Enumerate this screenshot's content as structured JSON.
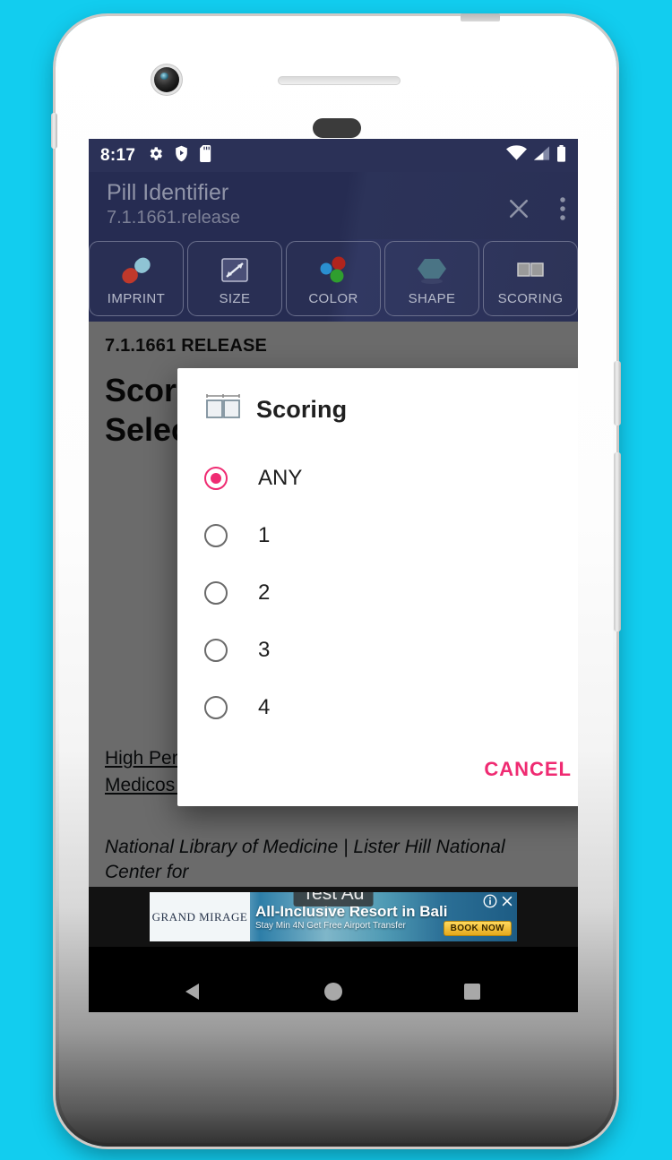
{
  "status_bar": {
    "time": "8:17",
    "left_icons": [
      "gear-icon",
      "shield-play-icon",
      "sd-card-icon"
    ],
    "right_icons": [
      "wifi-icon",
      "cellular-signal-icon",
      "battery-icon"
    ]
  },
  "app_bar": {
    "title": "Pill Identifier",
    "version": "7.1.1661.release",
    "close_label": "✕",
    "overflow_label": "⋮"
  },
  "tabs": [
    {
      "label": "IMPRINT",
      "icon": "pill-capsule-icon"
    },
    {
      "label": "SIZE",
      "icon": "size-ruler-icon"
    },
    {
      "label": "COLOR",
      "icon": "color-spheres-icon"
    },
    {
      "label": "SHAPE",
      "icon": "hexagon-shape-icon"
    },
    {
      "label": "SCORING",
      "icon": "scoring-table-icon"
    }
  ],
  "page": {
    "release_heading": "7.1.1661 RELEASE",
    "title_line1": "Scoring",
    "title_line2": "Selection",
    "link_text": "High Performance Computing and Communications | Medicos Consultants LLC",
    "italic_text": "National Library of Medicine | Lister Hill National Center for"
  },
  "ad": {
    "test_label": "Test Ad",
    "brand": "GRAND MIRAGE",
    "headline": "All-Inclusive Resort in Bali",
    "subline": "Stay Min 4N Get Free Airport Transfer",
    "cta": "BOOK NOW",
    "info_icon": "info-icon",
    "close_icon": "close-icon"
  },
  "dialog": {
    "icon": "scoring-table-icon",
    "title": "Scoring",
    "options": [
      {
        "label": "ANY",
        "selected": true
      },
      {
        "label": "1",
        "selected": false
      },
      {
        "label": "2",
        "selected": false
      },
      {
        "label": "3",
        "selected": false
      },
      {
        "label": "4",
        "selected": false
      }
    ],
    "cancel_label": "CANCEL"
  },
  "nav_bar": {
    "back_label": "back-triangle-icon",
    "home_label": "home-circle-icon",
    "recents_label": "recents-square-icon"
  },
  "colors": {
    "accent": "#ef2b72",
    "app_bar": "#262c52",
    "background": "#12CDEF",
    "status_bar": "#2b3157"
  }
}
